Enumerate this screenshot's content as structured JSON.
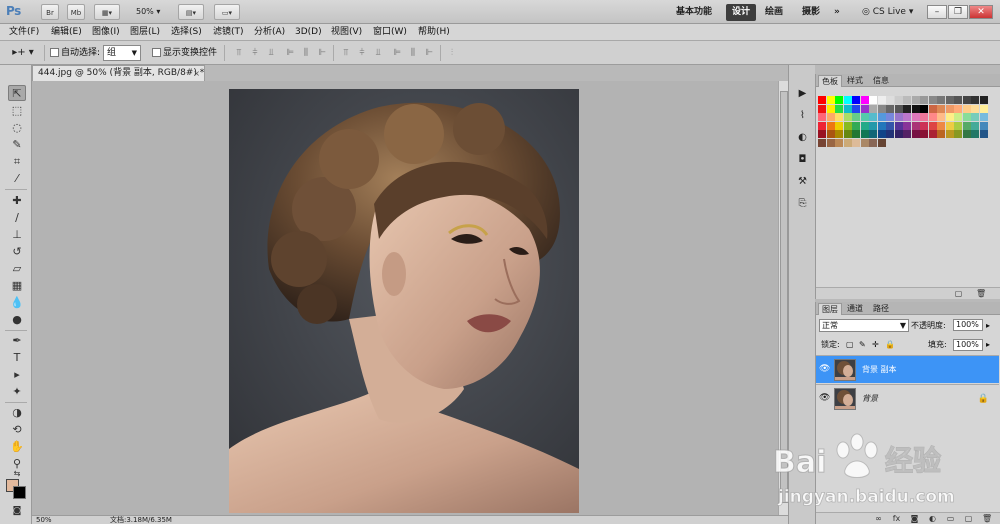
{
  "app": {
    "logo": "Ps",
    "bar_buttons": [
      "Br",
      "Mb"
    ],
    "zoom_select": "50%",
    "workspaces": [
      "基本功能",
      "设计",
      "绘画",
      "摄影"
    ],
    "active_workspace": "设计",
    "more": "»",
    "cslive": "CS Live"
  },
  "menu": [
    "文件(F)",
    "编辑(E)",
    "图像(I)",
    "图层(L)",
    "选择(S)",
    "滤镜(T)",
    "分析(A)",
    "3D(D)",
    "视图(V)",
    "窗口(W)",
    "帮助(H)"
  ],
  "options": {
    "auto_select_label": "自动选择:",
    "auto_select_value": "组",
    "show_transform_label": "显示变换控件"
  },
  "document": {
    "tab_title": "444.jpg @ 50% (背景 副本, RGB/8#) *",
    "close": "×",
    "status_zoom": "50%",
    "status_info": "文档:3.18M/6.35M"
  },
  "color_panel": {
    "tabs": [
      "色板",
      "样式",
      "信息"
    ],
    "active_tab": "色板",
    "swatch_rows": [
      [
        "#ff0000",
        "#ffff00",
        "#00ff00",
        "#00ffff",
        "#0000ff",
        "#ff00ff",
        "#ffffff",
        "#eeeeee",
        "#dddddd",
        "#cccccc",
        "#bbbbbb",
        "#aaaaaa",
        "#999999",
        "#888888",
        "#777777",
        "#666666",
        "#555555",
        "#444444",
        "#333333",
        "#222222"
      ],
      [
        "#ee1111",
        "#ffee00",
        "#22dd44",
        "#11bbcc",
        "#2244ee",
        "#9933cc",
        "#aaaaaa",
        "#888888",
        "#666666",
        "#555555",
        "#222222",
        "#111111",
        "#000000",
        "#cc6644",
        "#dd8855",
        "#ee9966",
        "#ffaa77",
        "#ffcc88",
        "#ffdd99",
        "#ffee99"
      ],
      [
        "#ff6677",
        "#ffaa66",
        "#ffdd66",
        "#aadd66",
        "#66cc88",
        "#55ccaa",
        "#55bbcc",
        "#5599dd",
        "#7788dd",
        "#9977cc",
        "#bb77cc",
        "#dd77bb",
        "#ee7799",
        "#ff8888",
        "#ffbb88",
        "#ffee88",
        "#ccee88",
        "#88dd99",
        "#77ccbb",
        "#77bbdd"
      ],
      [
        "#ee2233",
        "#ee7711",
        "#eecc00",
        "#88bb22",
        "#33aa55",
        "#22aa88",
        "#2299aa",
        "#2277bb",
        "#3355aa",
        "#553399",
        "#883399",
        "#aa3377",
        "#cc3355",
        "#dd4444",
        "#ee8844",
        "#eecc44",
        "#aacc44",
        "#55aa66",
        "#44aa99",
        "#4488bb"
      ],
      [
        "#991122",
        "#aa5511",
        "#aa8800",
        "#668811",
        "#227733",
        "#117755",
        "#116677",
        "#114488",
        "#223377",
        "#332266",
        "#552266",
        "#771144",
        "#881133",
        "#aa2233",
        "#bb6622",
        "#bb9922",
        "#889922",
        "#337744",
        "#227766",
        "#225588"
      ],
      [
        "#774433",
        "#996644",
        "#bb8855",
        "#ccaa77",
        "#ddbb99",
        "#aa8866",
        "#886655",
        "#664433"
      ]
    ]
  },
  "layers_panel": {
    "tabs": [
      "图层",
      "通道",
      "路径"
    ],
    "active_tab": "图层",
    "blend_mode": "正常",
    "opacity_label": "不透明度:",
    "opacity": "100%",
    "lock_label": "锁定:",
    "fill_label": "填充:",
    "fill": "100%",
    "layers": [
      {
        "name": "背景 副本",
        "selected": true,
        "locked": false
      },
      {
        "name": "背景",
        "selected": false,
        "locked": true
      }
    ]
  },
  "watermark": {
    "brand": "Bai",
    "brand_cn": "经验",
    "url": "jingyan.baidu.com"
  },
  "colors": {
    "selection_blue": "#3d94f6",
    "foreground": "#e3b99c",
    "background": "#000000"
  }
}
